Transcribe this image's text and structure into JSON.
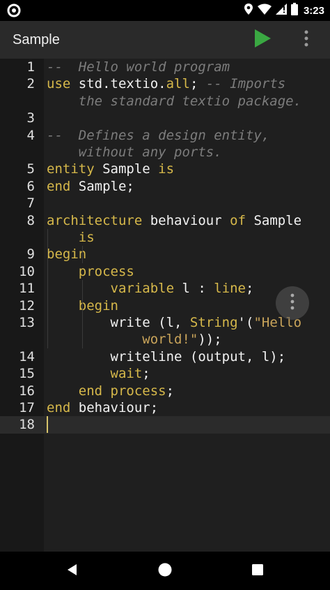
{
  "status_bar": {
    "time": "3:23"
  },
  "app_bar": {
    "title": "Sample",
    "icons": {
      "run": "play-icon",
      "overflow": "more-vert-icon"
    }
  },
  "editor": {
    "current_line": "18",
    "lines": [
      {
        "num": "1",
        "rows": [
          [
            [
              "cm",
              "--  Hello world program"
            ]
          ]
        ]
      },
      {
        "num": "2",
        "rows": [
          [
            [
              "kw",
              "use"
            ],
            [
              "pl",
              " std.textio."
            ],
            [
              "kw",
              "all"
            ],
            [
              "pl",
              "; "
            ],
            [
              "cm",
              "-- Imports"
            ]
          ],
          [
            [
              "cm",
              "    the standard textio package."
            ]
          ]
        ]
      },
      {
        "num": "3",
        "rows": [
          [
            [
              "pl",
              ""
            ]
          ]
        ]
      },
      {
        "num": "4",
        "rows": [
          [
            [
              "cm",
              "--  Defines a design entity,"
            ]
          ],
          [
            [
              "cm",
              "    without any ports."
            ]
          ]
        ]
      },
      {
        "num": "5",
        "rows": [
          [
            [
              "kw",
              "entity"
            ],
            [
              "pl",
              " Sample "
            ],
            [
              "kw",
              "is"
            ]
          ]
        ]
      },
      {
        "num": "6",
        "rows": [
          [
            [
              "kw",
              "end"
            ],
            [
              "pl",
              " Sample;"
            ]
          ]
        ]
      },
      {
        "num": "7",
        "rows": [
          [
            [
              "pl",
              ""
            ]
          ]
        ]
      },
      {
        "num": "8",
        "rows": [
          [
            [
              "kw",
              "architecture"
            ],
            [
              "pl",
              " behaviour "
            ],
            [
              "kw",
              "of"
            ],
            [
              "pl",
              " Sample"
            ]
          ],
          [
            [
              "pl",
              "    "
            ],
            [
              "kw",
              "is"
            ]
          ]
        ]
      },
      {
        "num": "9",
        "rows": [
          [
            [
              "kw",
              "begin"
            ]
          ]
        ]
      },
      {
        "num": "10",
        "rows": [
          [
            [
              "pl",
              "    "
            ],
            [
              "kw",
              "process"
            ]
          ]
        ]
      },
      {
        "num": "11",
        "rows": [
          [
            [
              "pl",
              "        "
            ],
            [
              "kw",
              "variable"
            ],
            [
              "pl",
              " l : "
            ],
            [
              "kw",
              "line"
            ],
            [
              "pl",
              ";"
            ]
          ]
        ]
      },
      {
        "num": "12",
        "rows": [
          [
            [
              "pl",
              "    "
            ],
            [
              "kw",
              "begin"
            ]
          ]
        ]
      },
      {
        "num": "13",
        "rows": [
          [
            [
              "pl",
              "        write (l, "
            ],
            [
              "kw",
              "String"
            ],
            [
              "pl",
              "'("
            ],
            [
              "st",
              "\"Hello"
            ]
          ],
          [
            [
              "st",
              "            world!\""
            ],
            [
              "pl",
              "));"
            ]
          ]
        ]
      },
      {
        "num": "14",
        "rows": [
          [
            [
              "pl",
              "        writeline (output, l);"
            ]
          ]
        ]
      },
      {
        "num": "15",
        "rows": [
          [
            [
              "pl",
              "        "
            ],
            [
              "kw",
              "wait"
            ],
            [
              "pl",
              ";"
            ]
          ]
        ]
      },
      {
        "num": "16",
        "rows": [
          [
            [
              "pl",
              "    "
            ],
            [
              "kw",
              "end process"
            ],
            [
              "pl",
              ";"
            ]
          ]
        ]
      },
      {
        "num": "17",
        "rows": [
          [
            [
              "kw",
              "end"
            ],
            [
              "pl",
              " behaviour;"
            ]
          ]
        ]
      },
      {
        "num": "18",
        "rows": [
          [
            [
              "pl",
              ""
            ]
          ]
        ]
      }
    ]
  },
  "nav_bar": {
    "icons": {
      "back": "back-triangle-icon",
      "home": "home-circle-icon",
      "recents": "recents-square-icon"
    }
  },
  "colors": {
    "keyword": "#d6b84a",
    "comment": "#7c7c7c",
    "string": "#c9a45a",
    "run_icon": "#3aa842",
    "app_bar": "#2a2a2a",
    "editor_bg": "#1f1f1f"
  }
}
